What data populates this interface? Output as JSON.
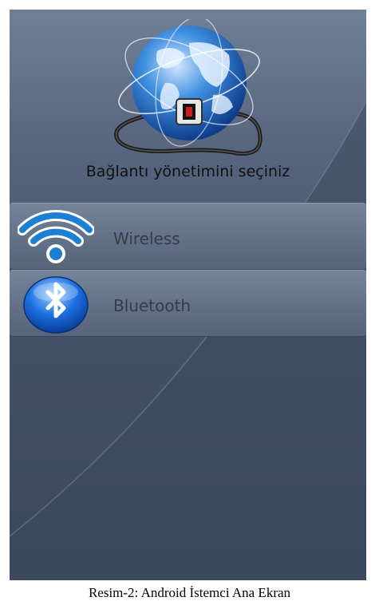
{
  "screen": {
    "prompt": "Bağlantı yönetimini seçiniz",
    "logo_icon": "globe-network-plug-icon",
    "items": [
      {
        "label": "Wireless",
        "icon": "wifi-icon",
        "icon_color": "#1c7fd3"
      },
      {
        "label": "Bluetooth",
        "icon": "bluetooth-icon",
        "icon_color": "#1c6fe0"
      }
    ]
  },
  "caption": "Resim-2:  Android İstemci Ana Ekran"
}
